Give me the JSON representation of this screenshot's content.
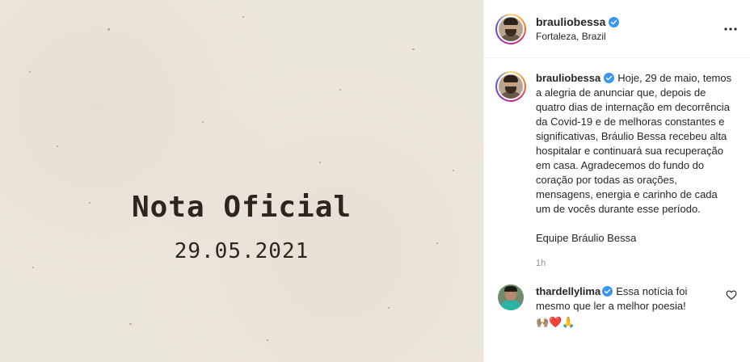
{
  "media": {
    "title": "Nota Oficial",
    "date": "29.05.2021",
    "background_color": "#ece7db",
    "text_color": "#2f2420"
  },
  "header": {
    "username": "brauliobessa",
    "location": "Fortaleza, Brazil",
    "verified_icon": "verified-badge-icon",
    "more_icon": "more-options-icon"
  },
  "caption": {
    "username": "brauliobessa",
    "text": "Hoje, 29 de maio, temos a alegria de anunciar que, depois de quatro dias de internação em decorrência da Covid-19 e de melhoras constantes e significativas, Bráulio Bessa recebeu alta hospitalar e continuará sua recuperação em casa. Agradecemos do fundo do coração por todas as orações, mensagens, energia e carinho de cada um de vocês durante esse período.",
    "signature": "Equipe Bráulio Bessa",
    "time": "1h"
  },
  "comment": {
    "username": "thardellylima",
    "text": "Essa notícia foi mesmo que ler a melhor poesia!",
    "emojis": "🙌🏽❤️🙏",
    "like_icon": "heart-outline-icon"
  },
  "colors": {
    "verified_blue": "#3897f0",
    "muted_text": "#8e8e8e",
    "border": "#efefef"
  }
}
